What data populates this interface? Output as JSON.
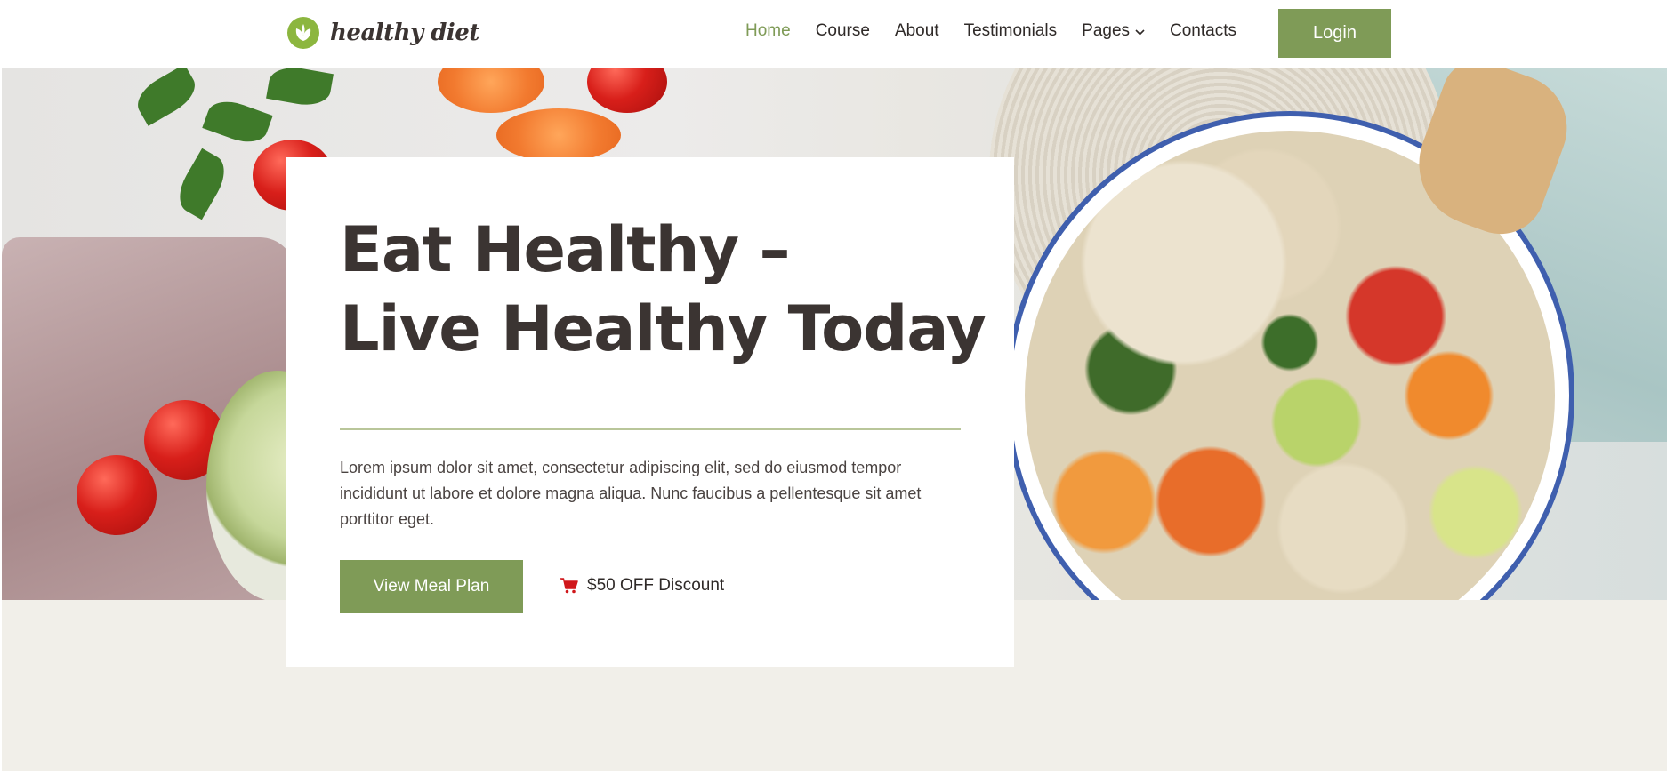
{
  "header": {
    "logo_text": "healthy diet",
    "nav": [
      {
        "label": "Home",
        "active": true
      },
      {
        "label": "Course"
      },
      {
        "label": "About"
      },
      {
        "label": "Testimonials"
      },
      {
        "label": "Pages",
        "has_dropdown": true
      },
      {
        "label": "Contacts"
      }
    ],
    "login_label": "Login"
  },
  "hero": {
    "headline_line1": "Eat Healthy –",
    "headline_line2": "Live Healthy Today",
    "body": "Lorem ipsum dolor sit amet, consectetur adipiscing elit, sed do eiusmod tempor incididunt ut labore et dolore magna aliqua. Nunc faucibus a pellentesque sit amet porttitor eget.",
    "cta_label": "View Meal Plan",
    "discount_label": "$50 OFF Discount",
    "discount_icon": "cart-icon"
  },
  "colors": {
    "accent": "#7f9b57",
    "logo_green": "#8cb63f",
    "text_dark": "#3b3432",
    "cart_red": "#d0171b",
    "lower_band": "#f1efe9"
  }
}
